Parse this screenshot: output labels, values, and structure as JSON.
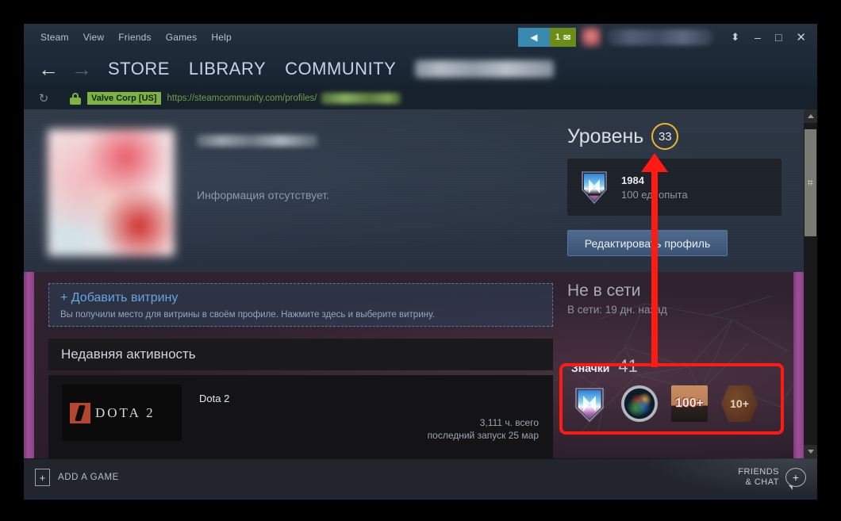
{
  "window": {
    "menu": [
      "Steam",
      "View",
      "Friends",
      "Games",
      "Help"
    ],
    "broadcast_icon": "broadcast-icon",
    "mail_count": "1",
    "mail_icon": "envelope-icon",
    "expand_icon": "expand-icon",
    "minimize_icon": "minimize-icon",
    "maximize_icon": "maximize-icon",
    "close_icon": "close-icon"
  },
  "nav": {
    "back_icon": "arrow-left-icon",
    "forward_icon": "arrow-right-icon",
    "links": [
      "STORE",
      "LIBRARY",
      "COMMUNITY"
    ]
  },
  "urlbar": {
    "reload_icon": "reload-icon",
    "lock_icon": "lock-icon",
    "cert_owner": "Valve Corp [US]",
    "url": "https://steamcommunity.com/profiles/"
  },
  "profile": {
    "avatar": "user-avatar",
    "summary": "Информация отсутствует.",
    "level_label": "Уровень",
    "level_value": "33",
    "xp": {
      "badge_icon": "game-badge-icon",
      "title": "1984",
      "subtitle": "100 ед. опыта"
    },
    "edit_button": "Редактировать профиль"
  },
  "showcase": {
    "title": "+ Добавить витрину",
    "subtitle": "Вы получили место для витрины в своём профиле. Нажмите здесь и выберите витрину."
  },
  "activity": {
    "header": "Недавняя активность",
    "game": {
      "capsule_icon": "dota2-capsule",
      "capsule_word": "DOTA 2",
      "name": "Dota 2",
      "hours": "3,111 ч. всего",
      "last_played": "последний запуск 25 мар"
    }
  },
  "status": {
    "state": "Не в сети",
    "last_online": "В сети: 19 дн. назад"
  },
  "badges": {
    "label": "Значки",
    "count": "41",
    "items": [
      {
        "name": "badge-game-1984",
        "text": ""
      },
      {
        "name": "badge-porthole",
        "text": ""
      },
      {
        "name": "badge-100-plus",
        "text": "100+"
      },
      {
        "name": "badge-10-plus",
        "text": "10+"
      }
    ]
  },
  "footer": {
    "add_game_icon": "plus-icon",
    "add_game": "ADD A GAME",
    "friends_line1": "FRIENDS",
    "friends_line2": "& CHAT",
    "friends_icon": "add-friend-icon"
  },
  "scrollbar": {
    "up_icon": "scroll-up-icon",
    "down_icon": "scroll-down-icon",
    "thumb": "scroll-thumb"
  },
  "annotations": {
    "highlight_box": "badges-highlight-box",
    "arrow": "arrow-to-level",
    "color": "#ff1a14"
  }
}
